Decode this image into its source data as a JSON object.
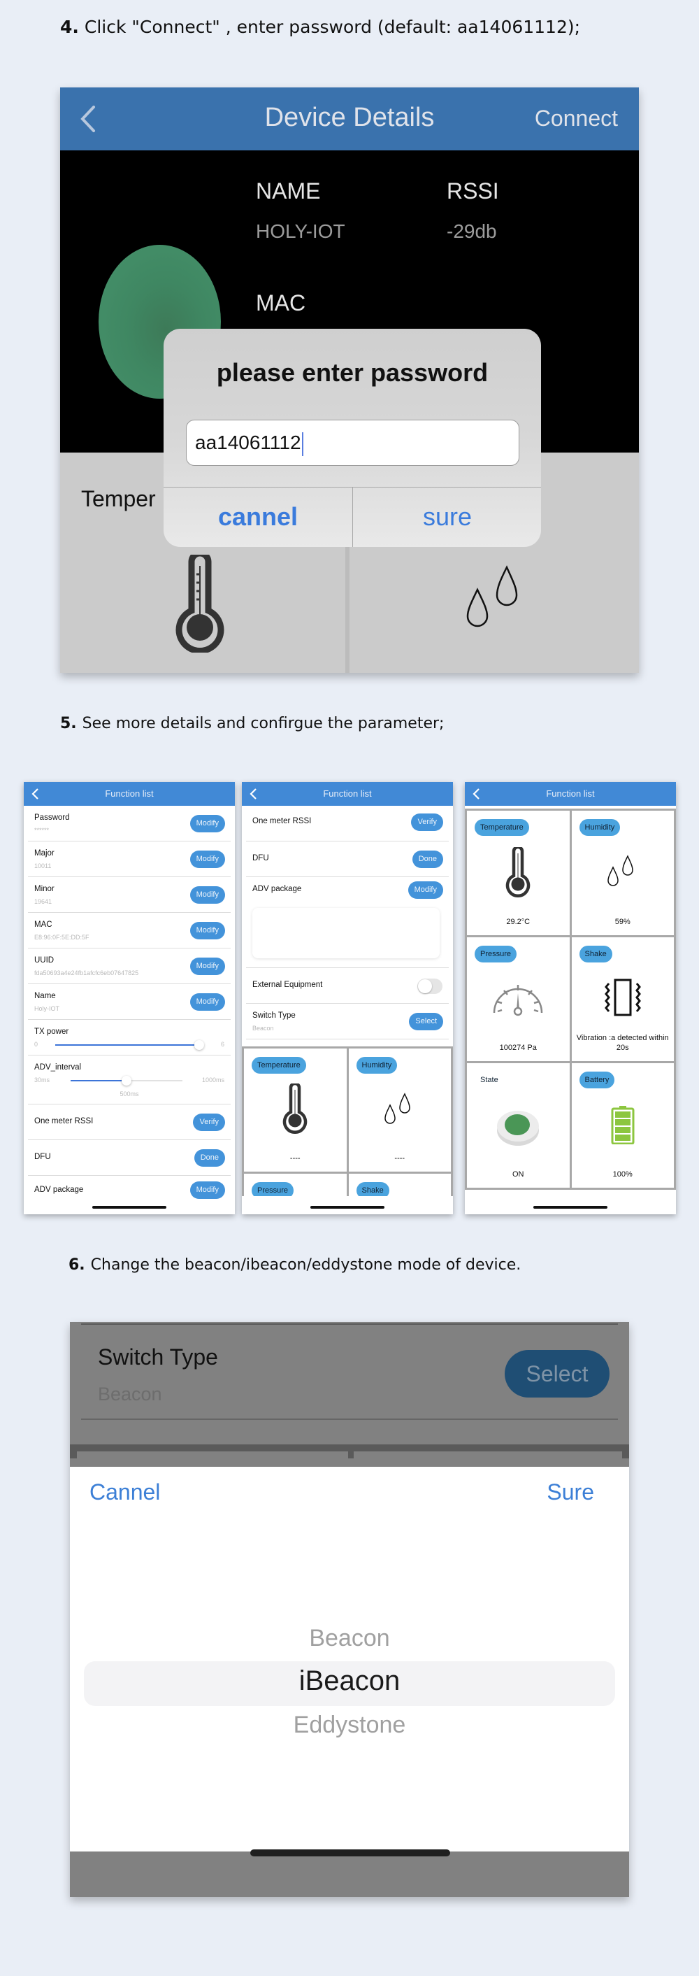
{
  "steps": {
    "step4": {
      "num": "4.",
      "text": "Click \"Connect\" , enter password (default: aa14061112);"
    },
    "step5": {
      "num": "5.",
      "text": "See more details and confirgue the parameter;"
    },
    "step6": {
      "num": "6.",
      "text": "Change the beacon/ibeacon/eddystone mode of device."
    }
  },
  "device_details": {
    "title": "Device Details",
    "connect_label": "Connect",
    "name_label": "NAME",
    "name_value": "HOLY-IOT",
    "rssi_label": "RSSI",
    "rssi_value": "-29db",
    "mac_label": "MAC",
    "temperature_label_partial": "Temper",
    "dialog": {
      "title": "please enter password",
      "input_value": "aa14061112",
      "cancel_label": "cannel",
      "sure_label": "sure"
    }
  },
  "function_list_1": {
    "title": "Function list",
    "rows": [
      {
        "label": "Password",
        "value": "******",
        "button": "Modify"
      },
      {
        "label": "Major",
        "value": "10011",
        "button": "Modify"
      },
      {
        "label": "Minor",
        "value": "19641",
        "button": "Modify"
      },
      {
        "label": "MAC",
        "value": "E8:96:0F:5E:DD:5F",
        "button": "Modify"
      },
      {
        "label": "UUID",
        "value": "fda50693a4e24fb1afcfc6eb07647825",
        "button": "Modify"
      },
      {
        "label": "Name",
        "value": "Holy-IOT",
        "button": "Modify"
      }
    ],
    "tx_power": {
      "label": "TX power",
      "min": "0",
      "max": "6",
      "value": 6,
      "fraction": 0.97
    },
    "adv_interval": {
      "label": "ADV_interval",
      "min": "30ms",
      "max": "1000ms",
      "value_label": "500ms",
      "fraction": 0.5
    },
    "rows2": [
      {
        "label": "One meter RSSI",
        "button": "Verify"
      },
      {
        "label": "DFU",
        "button": "Done"
      },
      {
        "label": "ADV package",
        "button": "Modify"
      }
    ]
  },
  "function_list_2": {
    "title": "Function list",
    "rows": [
      {
        "label": "One meter RSSI",
        "button": "Verify"
      },
      {
        "label": "DFU",
        "button": "Done"
      },
      {
        "label": "ADV package",
        "button": "Modify"
      }
    ],
    "external_equipment": {
      "label": "External Equipment",
      "on": false
    },
    "switch_type": {
      "label": "Switch Type",
      "value": "Beacon",
      "button": "Select"
    },
    "sensors": [
      {
        "tag": "Temperature",
        "value": "----"
      },
      {
        "tag": "Humidity",
        "value": "----"
      },
      {
        "tag": "Pressure"
      },
      {
        "tag": "Shake"
      }
    ]
  },
  "function_list_3": {
    "title": "Function list",
    "sensors": [
      {
        "tag": "Temperature",
        "value": "29.2°C"
      },
      {
        "tag": "Humidity",
        "value": "59%"
      },
      {
        "tag": "Pressure",
        "value": "100274 Pa"
      },
      {
        "tag": "Shake",
        "value": "Vibration :a  detected within 20s"
      },
      {
        "tag": "State",
        "value": "ON"
      },
      {
        "tag": "Battery",
        "value": "100%"
      }
    ]
  },
  "switch_type_picker": {
    "row_label": "Switch Type",
    "row_value": "Beacon",
    "select_label": "Select",
    "cancel_label": "Cannel",
    "sure_label": "Sure",
    "options": [
      "Beacon",
      "iBeacon",
      "Eddystone"
    ],
    "selected": "iBeacon"
  },
  "colors": {
    "nav_blue": "#3a72ad",
    "list_nav_blue": "#4189d6",
    "pill_blue": "#4393da",
    "tag_blue": "#4aa3de",
    "ios_blue": "#3a7bdc",
    "battery_green": "#8cc63f"
  }
}
